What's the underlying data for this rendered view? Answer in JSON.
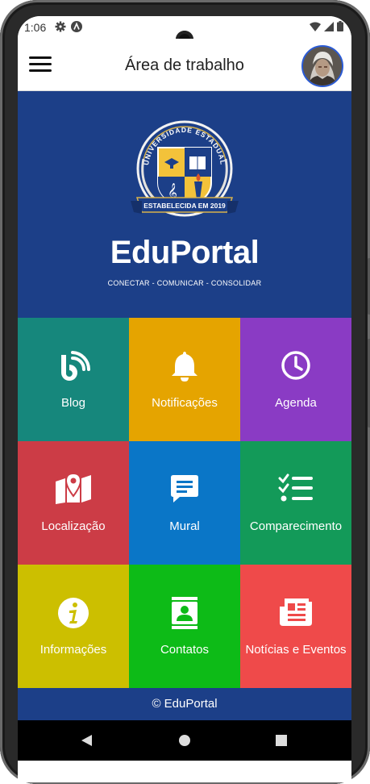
{
  "status_bar": {
    "time": "1:06",
    "icons": [
      "settings-icon",
      "a-badge-icon",
      "wifi-icon",
      "signal-icon",
      "battery-icon"
    ]
  },
  "app_bar": {
    "title": "Área de trabalho",
    "menu_icon": "hamburger-menu-icon",
    "avatar": "user-avatar"
  },
  "hero": {
    "crest_top_text": "UNIVERSIDADE ESTADUAL",
    "crest_ribbon_text": "ESTABELECIDA EM 2019",
    "brand": "EduPortal",
    "tagline": "CONECTAR - COMUNICAR - CONSOLIDAR"
  },
  "tiles": [
    {
      "label": "Blog",
      "icon": "blog-icon",
      "color": "#16877c"
    },
    {
      "label": "Notificações",
      "icon": "bell-icon",
      "color": "#e5a400"
    },
    {
      "label": "Agenda",
      "icon": "clock-icon",
      "color": "#8a3bc4"
    },
    {
      "label": "Localização",
      "icon": "map-pin-icon",
      "color": "#cc3c46"
    },
    {
      "label": "Mural",
      "icon": "message-icon",
      "color": "#0a76c7"
    },
    {
      "label": "Comparecimento",
      "icon": "checklist-icon",
      "color": "#139a59"
    },
    {
      "label": "Informações",
      "icon": "info-icon",
      "color": "#ccbf00"
    },
    {
      "label": "Contatos",
      "icon": "contacts-icon",
      "color": "#0dbb17"
    },
    {
      "label": "Notícias e Eventos",
      "icon": "newspaper-icon",
      "color": "#ef4a4a"
    }
  ],
  "footer": {
    "text": "© EduPortal"
  },
  "nav_bar": {
    "buttons": [
      "back-icon",
      "home-icon",
      "recents-icon"
    ]
  },
  "colors": {
    "primary": "#1c3f88"
  }
}
